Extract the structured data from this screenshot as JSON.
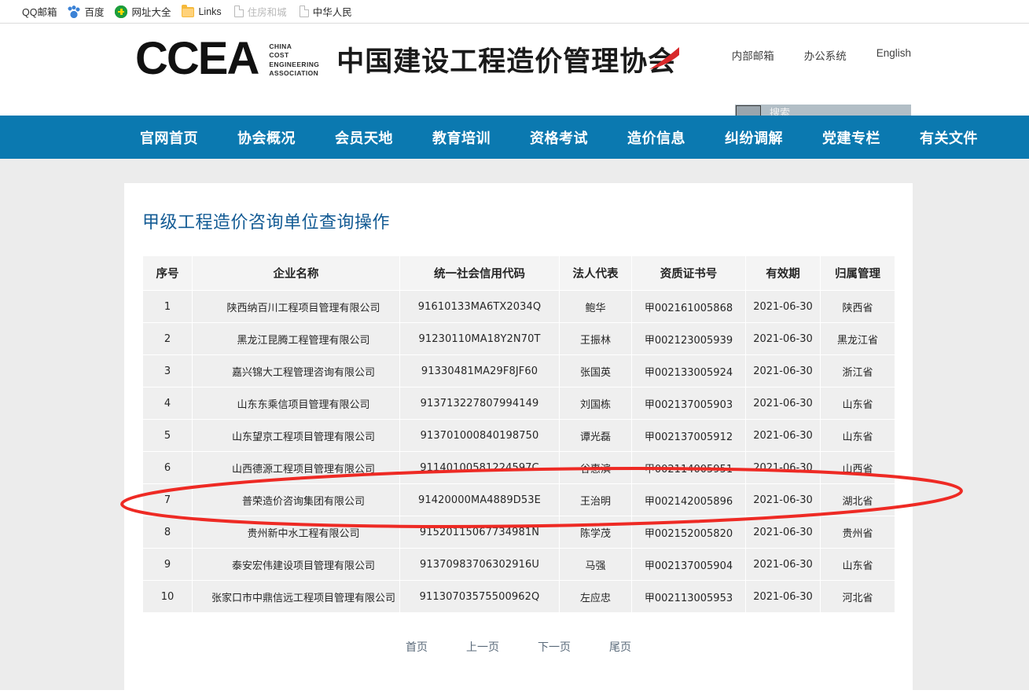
{
  "browser": {
    "bookmarks": [
      {
        "label": "QQ邮箱",
        "icon": "qq-icon",
        "faded": false
      },
      {
        "label": "百度",
        "icon": "baidu-icon",
        "faded": false
      },
      {
        "label": "网址大全",
        "icon": "hao123-icon",
        "faded": false
      },
      {
        "label": "Links",
        "icon": "folder-icon",
        "faded": false
      },
      {
        "label": "住房和城",
        "icon": "page-icon",
        "faded": true
      },
      {
        "label": "中华人民",
        "icon": "page-icon",
        "faded": false
      }
    ]
  },
  "header": {
    "logo_text": "CCEA",
    "logo_sub_lines": "CHINA\nCOST\nENGINEERING\nASSOCIATION",
    "logo_sub_1": "CHINA",
    "logo_sub_2": "COST",
    "logo_sub_3": "ENGINEERING",
    "logo_sub_4": "ASSOCIATION",
    "site_name": "中国建设工程造价管理协会",
    "top_links": [
      {
        "label": "内部邮箱"
      },
      {
        "label": "办公系统"
      },
      {
        "label": "English"
      }
    ],
    "search": {
      "placeholder": "搜索",
      "value": "",
      "button_label": ""
    }
  },
  "nav": {
    "items": [
      {
        "label": "官网首页"
      },
      {
        "label": "协会概况"
      },
      {
        "label": "会员天地"
      },
      {
        "label": "教育培训"
      },
      {
        "label": "资格考试"
      },
      {
        "label": "造价信息"
      },
      {
        "label": "纠纷调解"
      },
      {
        "label": "党建专栏"
      },
      {
        "label": "有关文件"
      }
    ]
  },
  "main": {
    "title": "甲级工程造价咨询单位查询操作",
    "table": {
      "columns": [
        "序号",
        "企业名称",
        "统一社会信用代码",
        "法人代表",
        "资质证书号",
        "有效期",
        "归属管理"
      ],
      "rows": [
        {
          "index": "1",
          "name": "陕西纳百川工程项目管理有限公司",
          "uscc": "91610133MA6TX2034Q",
          "rep": "鲍华",
          "cert": "甲002161005868",
          "valid": "2021-06-30",
          "province": "陕西省"
        },
        {
          "index": "2",
          "name": "黑龙江昆腾工程管理有限公司",
          "uscc": "91230110MA18Y2N70T",
          "rep": "王振林",
          "cert": "甲002123005939",
          "valid": "2021-06-30",
          "province": "黑龙江省"
        },
        {
          "index": "3",
          "name": "嘉兴锦大工程管理咨询有限公司",
          "uscc": "91330481MA29F8JF60",
          "rep": "张国英",
          "cert": "甲002133005924",
          "valid": "2021-06-30",
          "province": "浙江省"
        },
        {
          "index": "4",
          "name": "山东东乘信项目管理有限公司",
          "uscc": "913713227807994149",
          "rep": "刘国栋",
          "cert": "甲002137005903",
          "valid": "2021-06-30",
          "province": "山东省"
        },
        {
          "index": "5",
          "name": "山东望京工程项目管理有限公司",
          "uscc": "913701000840198750",
          "rep": "谭光磊",
          "cert": "甲002137005912",
          "valid": "2021-06-30",
          "province": "山东省"
        },
        {
          "index": "6",
          "name": "山西德源工程项目管理有限公司",
          "uscc": "91140100581224597C",
          "rep": "谷惠滨",
          "cert": "甲002114005951",
          "valid": "2021-06-30",
          "province": "山西省"
        },
        {
          "index": "7",
          "name": "普荣造价咨询集团有限公司",
          "uscc": "91420000MA4889D53E",
          "rep": "王治明",
          "cert": "甲002142005896",
          "valid": "2021-06-30",
          "province": "湖北省"
        },
        {
          "index": "8",
          "name": "贵州新中水工程有限公司",
          "uscc": "91520115067734981N",
          "rep": "陈学茂",
          "cert": "甲002152005820",
          "valid": "2021-06-30",
          "province": "贵州省"
        },
        {
          "index": "9",
          "name": "泰安宏伟建设项目管理有限公司",
          "uscc": "91370983706302916U",
          "rep": "马强",
          "cert": "甲002137005904",
          "valid": "2021-06-30",
          "province": "山东省"
        },
        {
          "index": "10",
          "name": "张家口市中鼎信远工程项目管理有限公司",
          "uscc": "91130703575500962Q",
          "rep": "左应忠",
          "cert": "甲002113005953",
          "valid": "2021-06-30",
          "province": "河北省"
        }
      ]
    },
    "pagination": [
      {
        "label": "首页"
      },
      {
        "label": "上一页"
      },
      {
        "label": "下一页"
      },
      {
        "label": "尾页"
      }
    ]
  },
  "annotation": {
    "shape": "ellipse",
    "color": "#ee2a24",
    "highlighted_row_index": "7"
  },
  "colors": {
    "nav_blue": "#0b79b0",
    "title_blue": "#135b94",
    "link_blue": "#2a6ebb",
    "page_bg": "#ececec",
    "annotation_red": "#ee2a24"
  }
}
